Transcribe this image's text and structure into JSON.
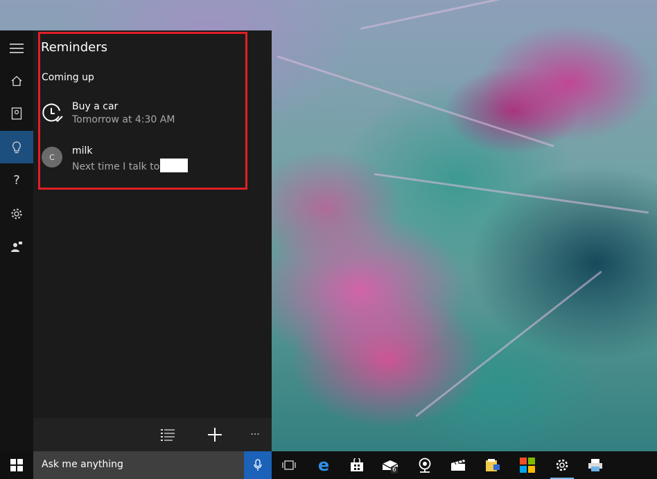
{
  "reminders": {
    "title": "Reminders",
    "section": "Coming up",
    "items": [
      {
        "name": "Buy a car",
        "detail": "Tomorrow at 4:30 AM",
        "icon": "alarm-clock-check-icon"
      },
      {
        "name": "milk",
        "detail": "Next time I talk to",
        "avatar_initial": "C",
        "icon": "contact-avatar"
      }
    ]
  },
  "rail": {
    "items": [
      "hamburger-menu-icon",
      "home-icon",
      "notebook-icon",
      "reminders-lightbulb-icon",
      "help-icon",
      "settings-gear-icon",
      "feedback-person-icon"
    ],
    "active": "reminders-lightbulb-icon"
  },
  "bottombar": {
    "items": [
      "list-view-icon",
      "add-icon",
      "more-ellipsis-icon"
    ],
    "more_label": "···"
  },
  "taskbar": {
    "search_placeholder": "Ask me anything",
    "mail_badge": "6",
    "items": [
      "task-view-icon",
      "edge-browser-icon",
      "store-icon",
      "mail-icon",
      "camera-icon",
      "movies-icon",
      "file-explorer-icon",
      "microsoft-store-logo-icon",
      "settings-gear-icon",
      "printer-icon"
    ],
    "active": "settings-gear-icon"
  },
  "colors": {
    "accent": "#1c62b9",
    "rail_active": "#1c4e7e",
    "highlight_border": "#e21e26"
  }
}
